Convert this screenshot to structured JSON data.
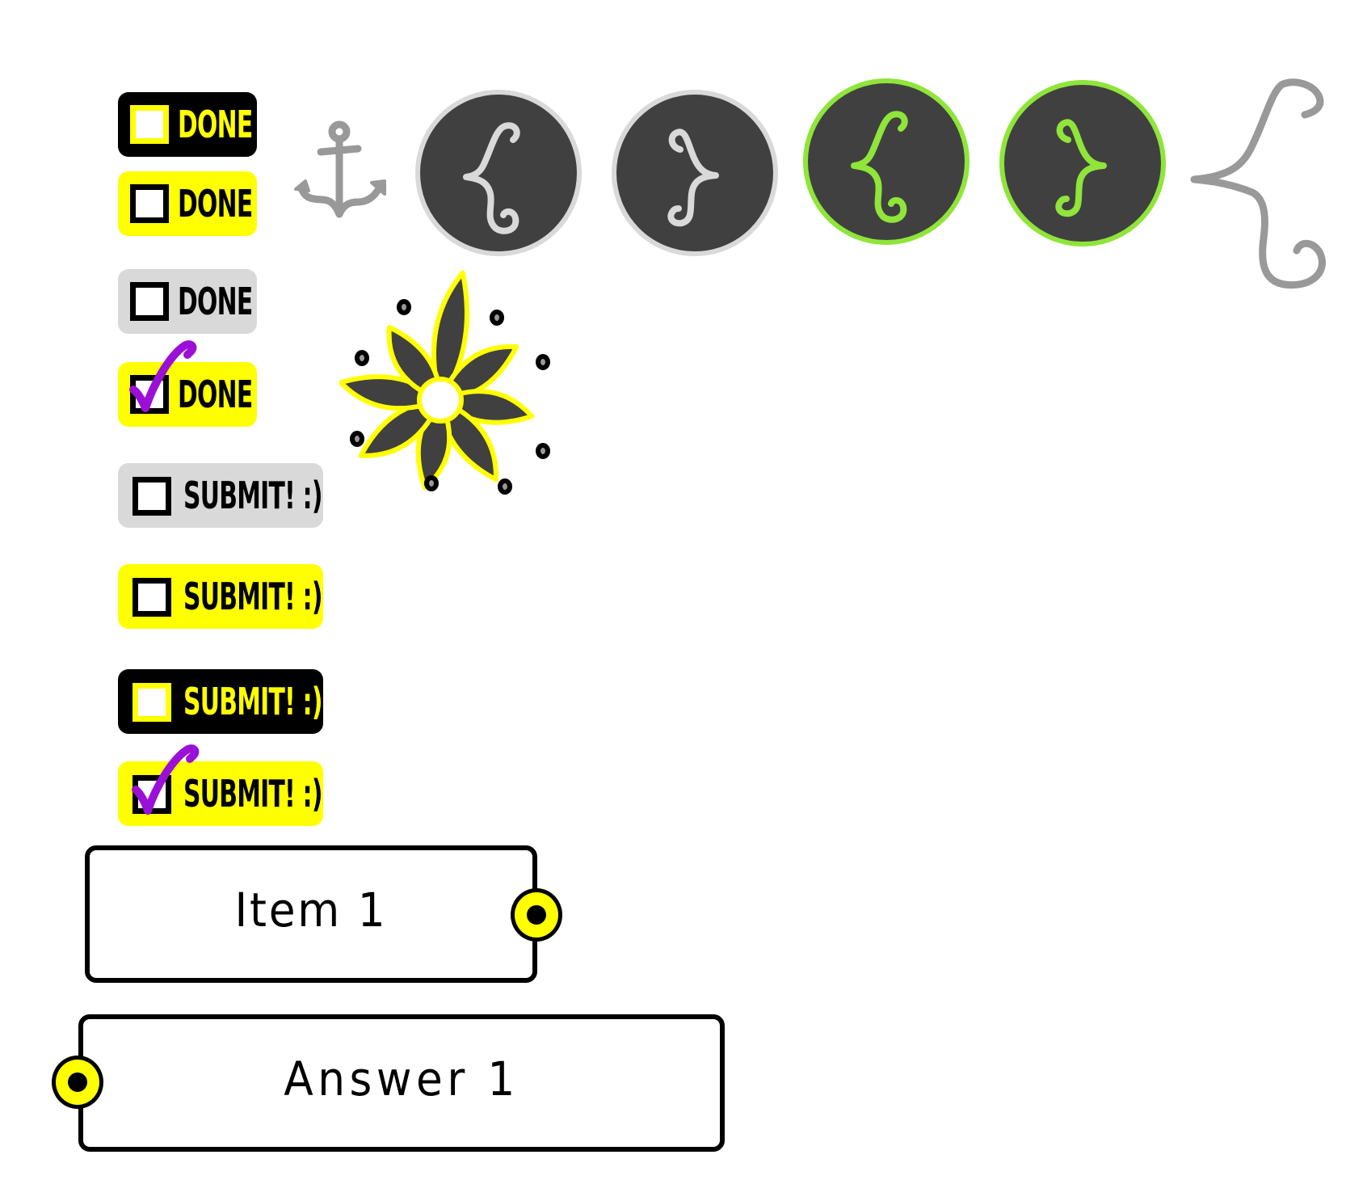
{
  "colors": {
    "accent_yellow": "#ffff00",
    "black": "#000000",
    "button_gray": "#d9d9d9",
    "check_purple": "#9b10d6",
    "icon_dark": "#404040",
    "icon_border_gray": "#d9d9d9",
    "icon_border_green": "#8fe53a",
    "icon_stroke_gray": "#999999"
  },
  "toggle_buttons": [
    {
      "label": "DONE",
      "style": "black",
      "checked": false
    },
    {
      "label": "DONE",
      "style": "yellow",
      "checked": false
    },
    {
      "label": "DONE",
      "style": "gray",
      "checked": false
    },
    {
      "label": "DONE",
      "style": "yellow",
      "checked": true
    },
    {
      "label": "SUBMIT! :)",
      "style": "gray",
      "checked": false
    },
    {
      "label": "SUBMIT! :)",
      "style": "yellow",
      "checked": false
    },
    {
      "label": "SUBMIT! :)",
      "style": "black",
      "checked": false
    },
    {
      "label": "SUBMIT! :)",
      "style": "yellow",
      "checked": true
    }
  ],
  "icons": {
    "anchor": "anchor-icon",
    "brace_buttons": [
      {
        "icon": "left-brace-icon",
        "state": "default"
      },
      {
        "icon": "right-brace-icon",
        "state": "default"
      },
      {
        "icon": "left-brace-icon",
        "state": "active"
      },
      {
        "icon": "right-brace-icon",
        "state": "active"
      }
    ],
    "large_brace": "large-left-brace-icon",
    "flower": "flower-icon"
  },
  "matching": {
    "item": {
      "label": "Item 1"
    },
    "answer": {
      "label": "Answer 1"
    }
  }
}
